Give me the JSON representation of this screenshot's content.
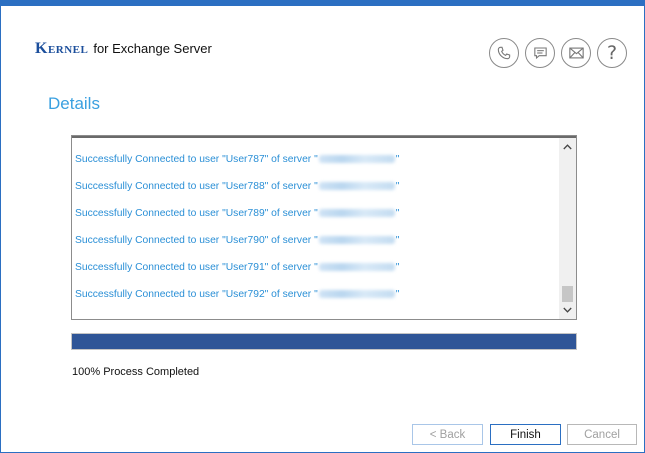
{
  "brand": {
    "logo_text": "Kernel",
    "product": "for Exchange Server"
  },
  "header_icons": [
    {
      "name": "phone-icon"
    },
    {
      "name": "chat-icon"
    },
    {
      "name": "email-icon"
    },
    {
      "name": "help-icon",
      "glyph": "?"
    }
  ],
  "section_title": "Details",
  "log": {
    "lines": [
      {
        "prefix": "Successfully Connected to user \"User787\" of server \"",
        "suffix": "\""
      },
      {
        "prefix": "Successfully Connected to user \"User788\" of server \"",
        "suffix": "\""
      },
      {
        "prefix": "Successfully Connected to user \"User789\" of server \"",
        "suffix": "\""
      },
      {
        "prefix": "Successfully Connected to user \"User790\" of server \"",
        "suffix": "\""
      },
      {
        "prefix": "Successfully Connected to user \"User791\" of server \"",
        "suffix": "\""
      },
      {
        "prefix": "Successfully Connected to user \"User792\" of server \"",
        "suffix": "\""
      }
    ]
  },
  "progress": {
    "value_percent": 100,
    "label": "100% Process Completed"
  },
  "buttons": {
    "back": "< Back",
    "finish": "Finish",
    "cancel": "Cancel"
  },
  "colors": {
    "accent": "#2b6fc2",
    "title": "#3aa0e0",
    "log_text": "#2a8fd6",
    "progress_fill": "#2f5597",
    "brand": "#1c4f9c"
  }
}
